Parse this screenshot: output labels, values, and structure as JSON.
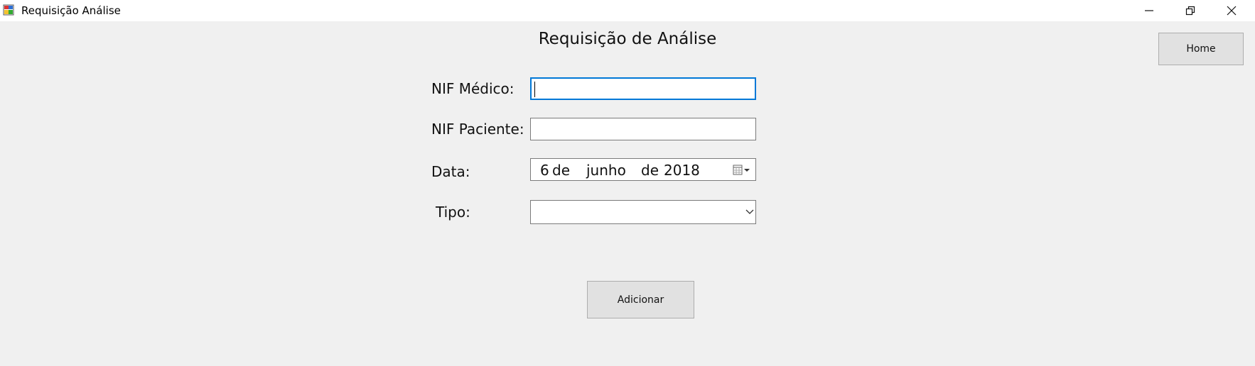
{
  "window": {
    "title": "Requisição Análise",
    "icon": "app-window-icon",
    "controls": [
      "minimize-icon",
      "restore-icon",
      "close-icon"
    ]
  },
  "form": {
    "title": "Requisição de Análise",
    "nif_medico": {
      "label": "NIF Médico:",
      "value": ""
    },
    "nif_paciente": {
      "label": "NIF Paciente:",
      "value": ""
    },
    "data": {
      "label": "Data:",
      "day": "6",
      "sep1": "de",
      "month": "junho",
      "sep2": "de",
      "year": "2018"
    },
    "tipo": {
      "label": "Tipo:",
      "value": ""
    }
  },
  "buttons": {
    "home": "Home",
    "adicionar": "Adicionar"
  },
  "colors": {
    "background": "#f0f0f0",
    "focus_border": "#0078d7",
    "button_bg": "#e1e1e1"
  }
}
